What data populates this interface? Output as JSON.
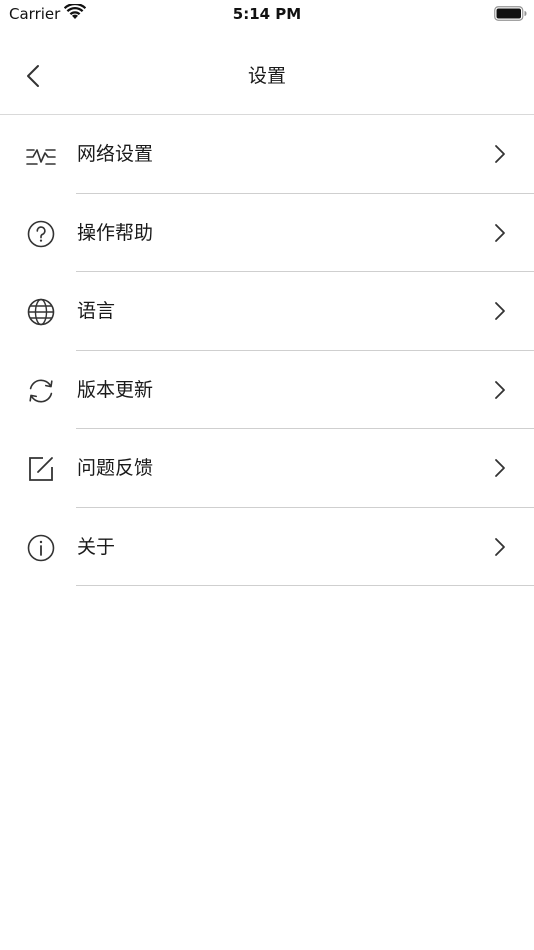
{
  "status_bar": {
    "carrier": "Carrier",
    "time": "5:14 PM"
  },
  "nav": {
    "title": "设置"
  },
  "settings": [
    {
      "label": "网络设置",
      "icon": "network-pulse-icon"
    },
    {
      "label": "操作帮助",
      "icon": "help-icon"
    },
    {
      "label": "语言",
      "icon": "globe-icon"
    },
    {
      "label": "版本更新",
      "icon": "refresh-icon"
    },
    {
      "label": "问题反馈",
      "icon": "edit-icon"
    },
    {
      "label": "关于",
      "icon": "info-icon"
    }
  ],
  "colors": {
    "icon": "#333333",
    "divider": "#cfcfcf",
    "text": "#1a1a1a",
    "background": "#ffffff"
  }
}
